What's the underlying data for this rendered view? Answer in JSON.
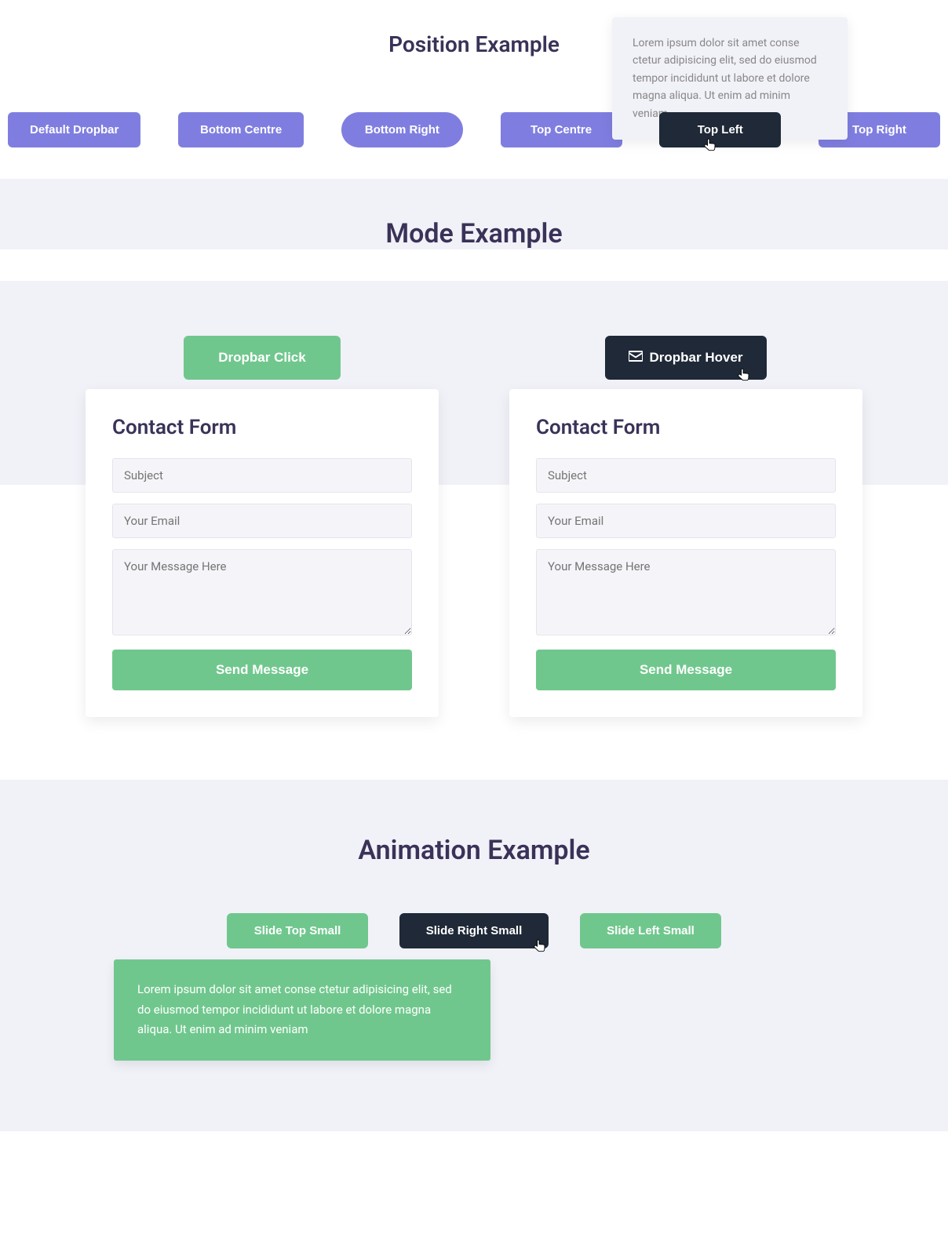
{
  "position": {
    "heading": "Position Example",
    "buttons": [
      "Default Dropbar",
      "Bottom Centre",
      "Bottom Right",
      "Top Centre",
      "Top Left",
      "Top Right"
    ],
    "tooltip": "Lorem ipsum dolor sit amet conse ctetur adipisicing elit, sed do eiusmod tempor incididunt ut labore et dolore magna aliqua. Ut enim ad minim veniam"
  },
  "mode": {
    "heading": "Mode Example",
    "click_label": "Dropbar Click",
    "hover_label": "Dropbar Hover",
    "form": {
      "title": "Contact Form",
      "subject_placeholder": "Subject",
      "email_placeholder": "Your Email",
      "message_placeholder": "Your Message Here",
      "send_label": "Send Message"
    }
  },
  "animation": {
    "heading": "Animation Example",
    "buttons": [
      "Slide Top Small",
      "Slide Right Small",
      "Slide Left Small"
    ],
    "drop_text": "Lorem ipsum dolor sit amet conse ctetur adipisicing elit, sed do eiusmod tempor incididunt ut labore et dolore magna aliqua. Ut enim ad minim veniam"
  }
}
